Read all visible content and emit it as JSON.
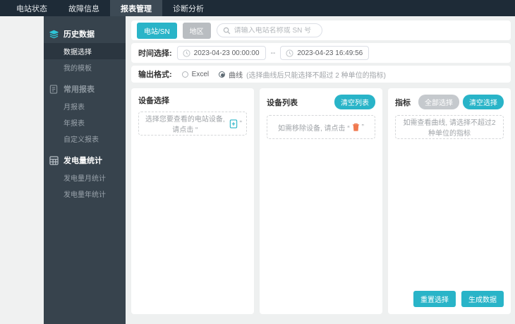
{
  "topnav": {
    "items": [
      {
        "label": "电站状态",
        "active": false
      },
      {
        "label": "故障信息",
        "active": false
      },
      {
        "label": "报表管理",
        "active": true
      },
      {
        "label": "诊断分析",
        "active": false
      }
    ]
  },
  "sidebar": {
    "groups": [
      {
        "icon": "layers-icon",
        "label": "历史数据",
        "items": [
          {
            "label": "数据选择",
            "active": true
          },
          {
            "label": "我的模板",
            "active": false
          }
        ]
      },
      {
        "icon": "report-icon",
        "label": "常用报表",
        "items": [
          {
            "label": "月报表",
            "active": false
          },
          {
            "label": "年报表",
            "active": false
          },
          {
            "label": "自定义报表",
            "active": false
          }
        ]
      },
      {
        "icon": "grid-icon",
        "label": "发电量统计",
        "items": [
          {
            "label": "发电量月统计",
            "active": false
          },
          {
            "label": "发电量年统计",
            "active": false
          }
        ]
      }
    ]
  },
  "filters": {
    "station_button": "电站/SN",
    "region_button": "地区",
    "search_placeholder": "请输入电站名称或 SN 号",
    "time_label": "时间选择:",
    "time_start": "2023-04-23 00:00:00",
    "time_separator": "--",
    "time_end": "2023-04-23 16:49:56",
    "format_label": "输出格式:",
    "format_options": [
      {
        "label": "Excel",
        "selected": false
      },
      {
        "label": "曲线",
        "note": "(选择曲线后只能选择不超过 2 种单位的指标)",
        "selected": true
      }
    ]
  },
  "panels": {
    "device_select": {
      "title": "设备选择",
      "placeholder_prefix": "选择您要查看的电站设备, 请点击 “",
      "placeholder_icon": "doc-add-icon",
      "placeholder_suffix": "”"
    },
    "device_list": {
      "title": "设备列表",
      "clear_button": "清空列表",
      "placeholder_prefix": "如需移除设备, 请点击 “",
      "placeholder_icon": "trash-icon",
      "placeholder_suffix": "”"
    },
    "metrics": {
      "title": "指标",
      "select_all_button": "全部选择",
      "clear_button": "清空选择",
      "placeholder": "如需查看曲线, 请选择不超过2种单位的指标",
      "reset_button": "重置选择",
      "generate_button": "生成数据"
    }
  },
  "colors": {
    "accent_teal": "#29b4c8",
    "navbar": "#1e2b37",
    "sidebar": "#37434d",
    "gray_button": "#b9bdc1",
    "trash_orange": "#f0794f"
  }
}
